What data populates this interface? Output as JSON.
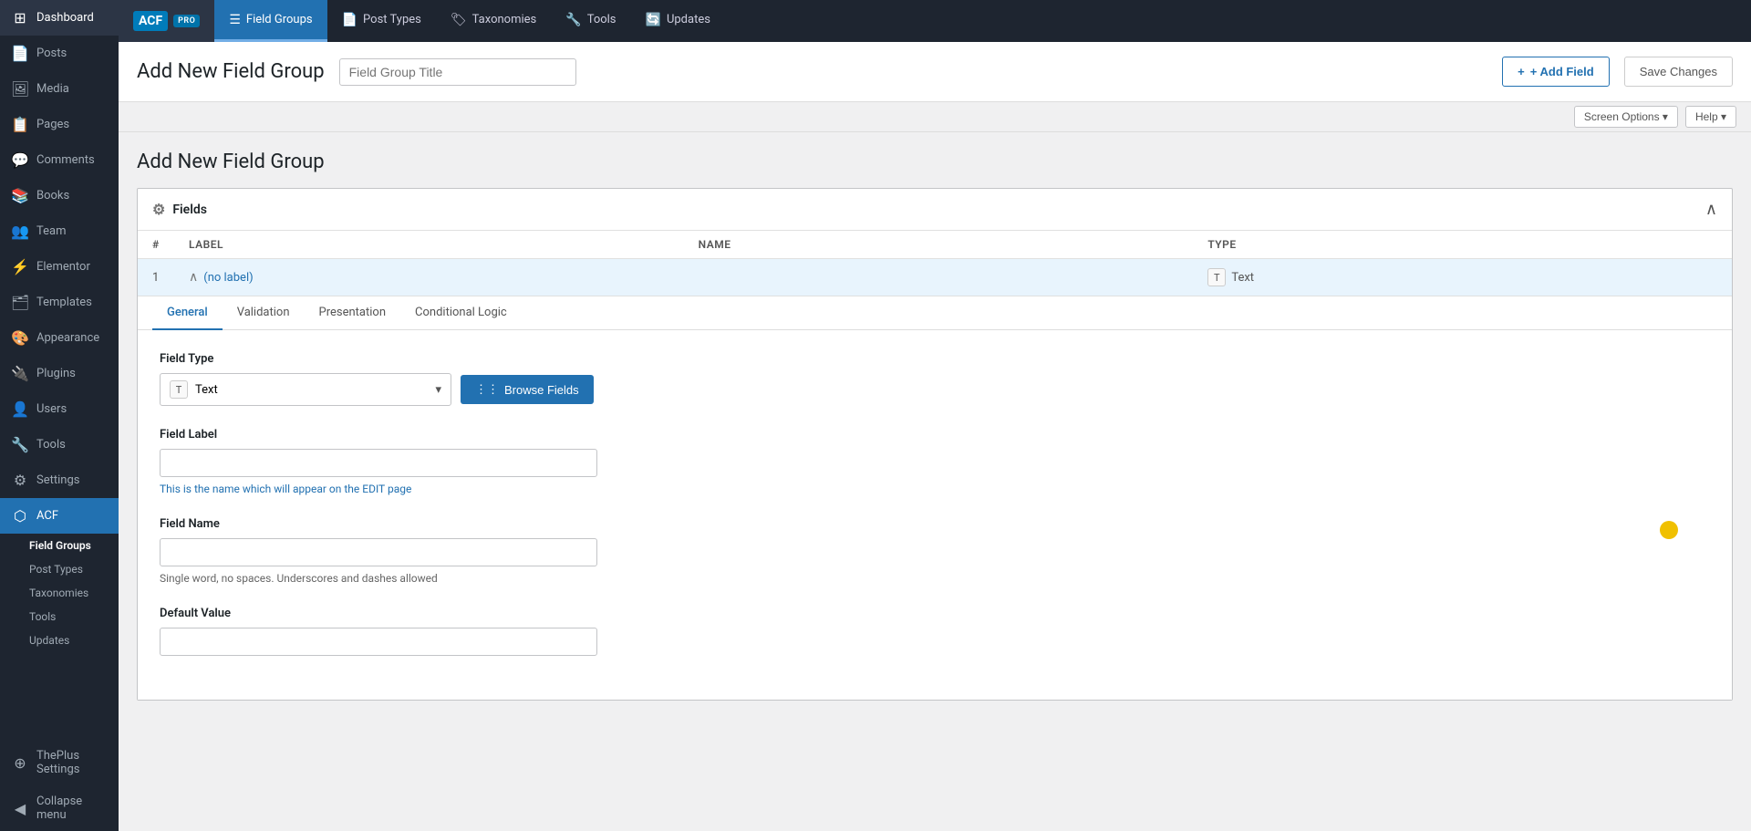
{
  "sidebar": {
    "items": [
      {
        "id": "dashboard",
        "label": "Dashboard",
        "icon": "⊞"
      },
      {
        "id": "posts",
        "label": "Posts",
        "icon": "📄"
      },
      {
        "id": "media",
        "label": "Media",
        "icon": "🖼"
      },
      {
        "id": "pages",
        "label": "Pages",
        "icon": "📋"
      },
      {
        "id": "comments",
        "label": "Comments",
        "icon": "💬"
      },
      {
        "id": "books",
        "label": "Books",
        "icon": "📚"
      },
      {
        "id": "team",
        "label": "Team",
        "icon": "👥"
      },
      {
        "id": "elementor",
        "label": "Elementor",
        "icon": "⚡"
      },
      {
        "id": "templates",
        "label": "Templates",
        "icon": "🗂"
      },
      {
        "id": "appearance",
        "label": "Appearance",
        "icon": "🎨"
      },
      {
        "id": "plugins",
        "label": "Plugins",
        "icon": "🔌"
      },
      {
        "id": "users",
        "label": "Users",
        "icon": "👤"
      },
      {
        "id": "tools",
        "label": "Tools",
        "icon": "🔧"
      },
      {
        "id": "settings",
        "label": "Settings",
        "icon": "⚙"
      },
      {
        "id": "acf",
        "label": "ACF",
        "icon": "⬡",
        "active": true
      }
    ],
    "acf_sub": [
      {
        "id": "field-groups",
        "label": "Field Groups",
        "active": true
      },
      {
        "id": "post-types",
        "label": "Post Types"
      },
      {
        "id": "taxonomies",
        "label": "Taxonomies"
      },
      {
        "id": "tools",
        "label": "Tools"
      },
      {
        "id": "updates",
        "label": "Updates"
      }
    ],
    "bottom": [
      {
        "id": "theplus",
        "label": "ThePlus Settings",
        "icon": "⊕"
      },
      {
        "id": "collapse",
        "label": "Collapse menu",
        "icon": "◀"
      }
    ]
  },
  "top_nav": {
    "logo_text": "ACF",
    "pro_badge": "PRO",
    "tabs": [
      {
        "id": "field-groups",
        "label": "Field Groups",
        "icon": "☰",
        "active": true
      },
      {
        "id": "post-types",
        "label": "Post Types",
        "icon": "📄"
      },
      {
        "id": "taxonomies",
        "label": "Taxonomies",
        "icon": "🏷"
      },
      {
        "id": "tools",
        "label": "Tools",
        "icon": "🔧"
      },
      {
        "id": "updates",
        "label": "Updates",
        "icon": "🔄"
      }
    ]
  },
  "header": {
    "title": "Add New Field Group",
    "title_input_placeholder": "Field Group Title",
    "add_field_label": "+ Add Field",
    "save_changes_label": "Save Changes"
  },
  "screen_options": {
    "screen_options_label": "Screen Options ▾",
    "help_label": "Help ▾"
  },
  "page": {
    "title": "Add New Field Group"
  },
  "fields_panel": {
    "header_icon": "⚙",
    "header_label": "Fields",
    "table_headers": [
      "#",
      "Label",
      "Name",
      "Type"
    ],
    "field_row": {
      "number": "1",
      "label": "(no label)",
      "name": "",
      "type_icon": "T",
      "type_label": "Text"
    }
  },
  "field_detail": {
    "tabs": [
      {
        "id": "general",
        "label": "General",
        "active": true
      },
      {
        "id": "validation",
        "label": "Validation"
      },
      {
        "id": "presentation",
        "label": "Presentation"
      },
      {
        "id": "conditional-logic",
        "label": "Conditional Logic"
      }
    ],
    "field_type_label": "Field Type",
    "field_type_icon": "T",
    "field_type_value": "Text",
    "browse_fields_label": "Browse Fields",
    "field_label_label": "Field Label",
    "field_label_placeholder": "",
    "field_label_hint": "This is the name which will appear on the EDIT page",
    "field_name_label": "Field Name",
    "field_name_placeholder": "",
    "field_name_hint": "Single word, no spaces. Underscores and dashes allowed",
    "default_value_label": "Default Value",
    "default_value_placeholder": ""
  }
}
